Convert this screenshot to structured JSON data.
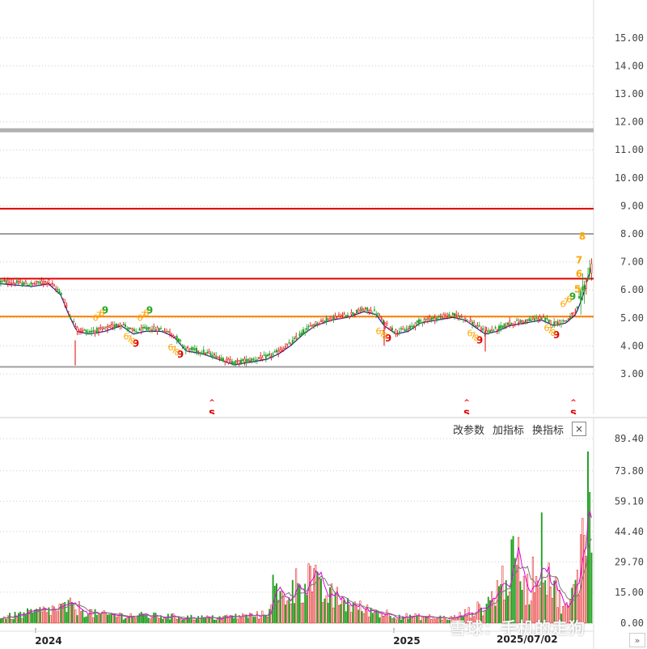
{
  "chart_data": [
    {
      "type": "candlestick",
      "title": "",
      "y_ticks": [
        "15.00",
        "14.00",
        "13.00",
        "12.00",
        "11.00",
        "10.00",
        "9.00",
        "8.00",
        "7.00",
        "6.00",
        "5.00",
        "4.00",
        "3.00"
      ],
      "ylim": [
        2.5,
        15.5
      ],
      "grid": true,
      "horizontal_lines": [
        {
          "value": 11.7,
          "color": "#b0b0b0",
          "style": "thick"
        },
        {
          "value": 8.9,
          "color": "#e00000",
          "style": "solid"
        },
        {
          "value": 8.0,
          "color": "#a0a0a0",
          "style": "solid"
        },
        {
          "value": 6.4,
          "color": "#e00000",
          "style": "solid"
        },
        {
          "value": 5.05,
          "color": "#ff8000",
          "style": "solid"
        },
        {
          "value": 3.25,
          "color": "#a0a0a0",
          "style": "solid"
        }
      ],
      "price_path": [
        [
          0,
          6.3
        ],
        [
          40,
          6.2
        ],
        [
          60,
          6.3
        ],
        [
          75,
          5.9
        ],
        [
          85,
          5.2
        ],
        [
          95,
          4.6
        ],
        [
          110,
          4.5
        ],
        [
          130,
          4.6
        ],
        [
          150,
          4.8
        ],
        [
          165,
          4.5
        ],
        [
          180,
          4.6
        ],
        [
          200,
          4.6
        ],
        [
          215,
          4.4
        ],
        [
          230,
          3.9
        ],
        [
          250,
          3.8
        ],
        [
          270,
          3.6
        ],
        [
          290,
          3.4
        ],
        [
          310,
          3.5
        ],
        [
          330,
          3.6
        ],
        [
          345,
          3.8
        ],
        [
          360,
          4.1
        ],
        [
          375,
          4.5
        ],
        [
          390,
          4.8
        ],
        [
          410,
          5.0
        ],
        [
          430,
          5.1
        ],
        [
          450,
          5.3
        ],
        [
          465,
          5.2
        ],
        [
          475,
          4.8
        ],
        [
          490,
          4.5
        ],
        [
          505,
          4.6
        ],
        [
          520,
          4.9
        ],
        [
          540,
          5.0
        ],
        [
          560,
          5.1
        ],
        [
          575,
          5.0
        ],
        [
          590,
          4.7
        ],
        [
          600,
          4.5
        ],
        [
          615,
          4.6
        ],
        [
          630,
          4.8
        ],
        [
          650,
          4.9
        ],
        [
          670,
          5.0
        ],
        [
          685,
          4.8
        ],
        [
          700,
          4.9
        ],
        [
          712,
          5.2
        ],
        [
          720,
          5.8
        ],
        [
          727,
          6.5
        ],
        [
          732,
          6.9
        ]
      ],
      "signals": [
        {
          "x": 130,
          "label": "9",
          "color": "#22aa22"
        },
        {
          "x": 168,
          "label": "9",
          "color": "#e00000"
        },
        {
          "x": 185,
          "label": "9",
          "color": "#22aa22"
        },
        {
          "x": 223,
          "label": "9",
          "color": "#e00000"
        },
        {
          "x": 480,
          "label": "9",
          "color": "#e00000"
        },
        {
          "x": 593,
          "label": "9",
          "color": "#e00000"
        },
        {
          "x": 688,
          "label": "9",
          "color": "#e00000"
        },
        {
          "x": 708,
          "label": "9",
          "color": "#22aa22"
        },
        {
          "x": 720,
          "label": "8",
          "color": "#ffa500"
        },
        {
          "x": 716,
          "label": "7",
          "color": "#ffa500"
        },
        {
          "x": 716,
          "label": "6",
          "color": "#ffa500"
        },
        {
          "x": 714,
          "label": "5",
          "color": "#ffa500"
        }
      ],
      "s_markers": [
        {
          "x": 262
        },
        {
          "x": 577
        },
        {
          "x": 709
        }
      ],
      "s_label": "s"
    },
    {
      "type": "bar",
      "title": "",
      "y_ticks": [
        "89.40",
        "73.80",
        "59.10",
        "44.40",
        "29.70",
        "15.00",
        "0.00"
      ],
      "ylim": [
        0,
        95
      ],
      "x_labels": [
        {
          "text": "2024",
          "x": 60
        },
        {
          "text": "2025",
          "x": 503
        }
      ],
      "volume_peaks": [
        [
          0,
          3
        ],
        [
          90,
          10
        ],
        [
          120,
          5
        ],
        [
          200,
          4
        ],
        [
          260,
          3
        ],
        [
          330,
          5
        ],
        [
          337,
          22
        ],
        [
          345,
          14
        ],
        [
          385,
          30
        ],
        [
          395,
          18
        ],
        [
          420,
          14
        ],
        [
          450,
          8
        ],
        [
          500,
          4
        ],
        [
          560,
          3
        ],
        [
          600,
          10
        ],
        [
          640,
          38
        ],
        [
          652,
          20
        ],
        [
          672,
          46
        ],
        [
          680,
          28
        ],
        [
          690,
          16
        ],
        [
          700,
          8
        ],
        [
          716,
          26
        ],
        [
          722,
          92
        ],
        [
          726,
          88
        ],
        [
          730,
          55
        ]
      ]
    }
  ],
  "toolbar": {
    "modify_params": "改参数",
    "add_indicator": "加指标",
    "switch_indicator": "换指标",
    "close_symbol": "×"
  },
  "footer": {
    "date": "2025/07/02",
    "watermark": "雪球：手机的走狗",
    "nav_arrows": "»"
  },
  "colors": {
    "up": "#e00000",
    "down": "#20a020",
    "ma": "#202090",
    "vol_ma1": "#e000e0",
    "vol_ma2": "#777777"
  }
}
